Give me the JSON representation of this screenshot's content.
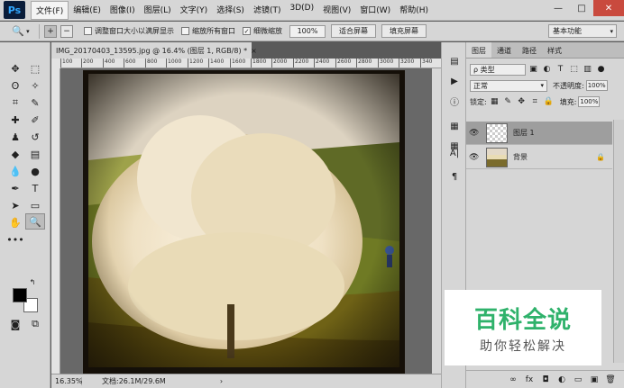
{
  "app": {
    "logo": "Ps",
    "menu": [
      "文件(F)",
      "编辑(E)",
      "图像(I)",
      "图层(L)",
      "文字(Y)",
      "选择(S)",
      "滤镜(T)",
      "3D(D)",
      "视图(V)",
      "窗口(W)",
      "帮助(H)"
    ],
    "window_controls": {
      "minimize": "—",
      "maximize": "□",
      "close": "✕"
    }
  },
  "options": {
    "tool_icon": "zoom-icon",
    "zoom_in": "+",
    "zoom_out": "−",
    "resize_windows": {
      "label": "调整窗口大小以满屏显示",
      "checked": false
    },
    "zoom_all": {
      "label": "缩放所有窗口",
      "checked": false
    },
    "scrubby": {
      "label": "细微缩放",
      "checked": true
    },
    "percent": "100%",
    "fit_screen": "适合屏幕",
    "fill_screen": "填充屏幕",
    "workspace": "基本功能"
  },
  "document": {
    "tab_title": "IMG_20170403_13595.jpg @ 16.4% (图层 1, RGB/8) *",
    "close": "×",
    "ruler_ticks": [
      "100",
      "200",
      "400",
      "600",
      "800",
      "1000",
      "1200",
      "1400",
      "1600",
      "1800",
      "2000",
      "2200",
      "2400",
      "2600",
      "2800",
      "3000",
      "3200",
      "340"
    ]
  },
  "status": {
    "zoom": "16.35%",
    "doc_info": "文档:26.1M/29.6M",
    "arrow": "›"
  },
  "layers_panel": {
    "tabs": [
      "图层",
      "通道",
      "路径",
      "样式"
    ],
    "filter_label": "ρ 类型",
    "blend_mode": "正常",
    "opacity_label": "不透明度:",
    "opacity_value": "100%",
    "lock_label": "锁定:",
    "fill_label": "填充:",
    "fill_value": "100%",
    "layers": [
      {
        "name": "图层 1",
        "selected": true,
        "thumb": "transparent"
      },
      {
        "name": "背景",
        "selected": false,
        "thumb": "image",
        "locked": true
      }
    ],
    "footer_icons": [
      "link-icon",
      "fx-icon",
      "mask-icon",
      "adjustment-icon",
      "group-icon",
      "new-layer-icon",
      "trash-icon"
    ],
    "footer_glyphs": [
      "∞",
      "fx",
      "◘",
      "◐",
      "▭",
      "▣",
      "🗑"
    ]
  },
  "watermark": {
    "title": "百科全说",
    "subtitle": "助你轻松解决"
  },
  "colors": {
    "title_green": "#2fb26b",
    "ui_gray": "#d6d6d6",
    "canvas_bg": "#686868"
  }
}
